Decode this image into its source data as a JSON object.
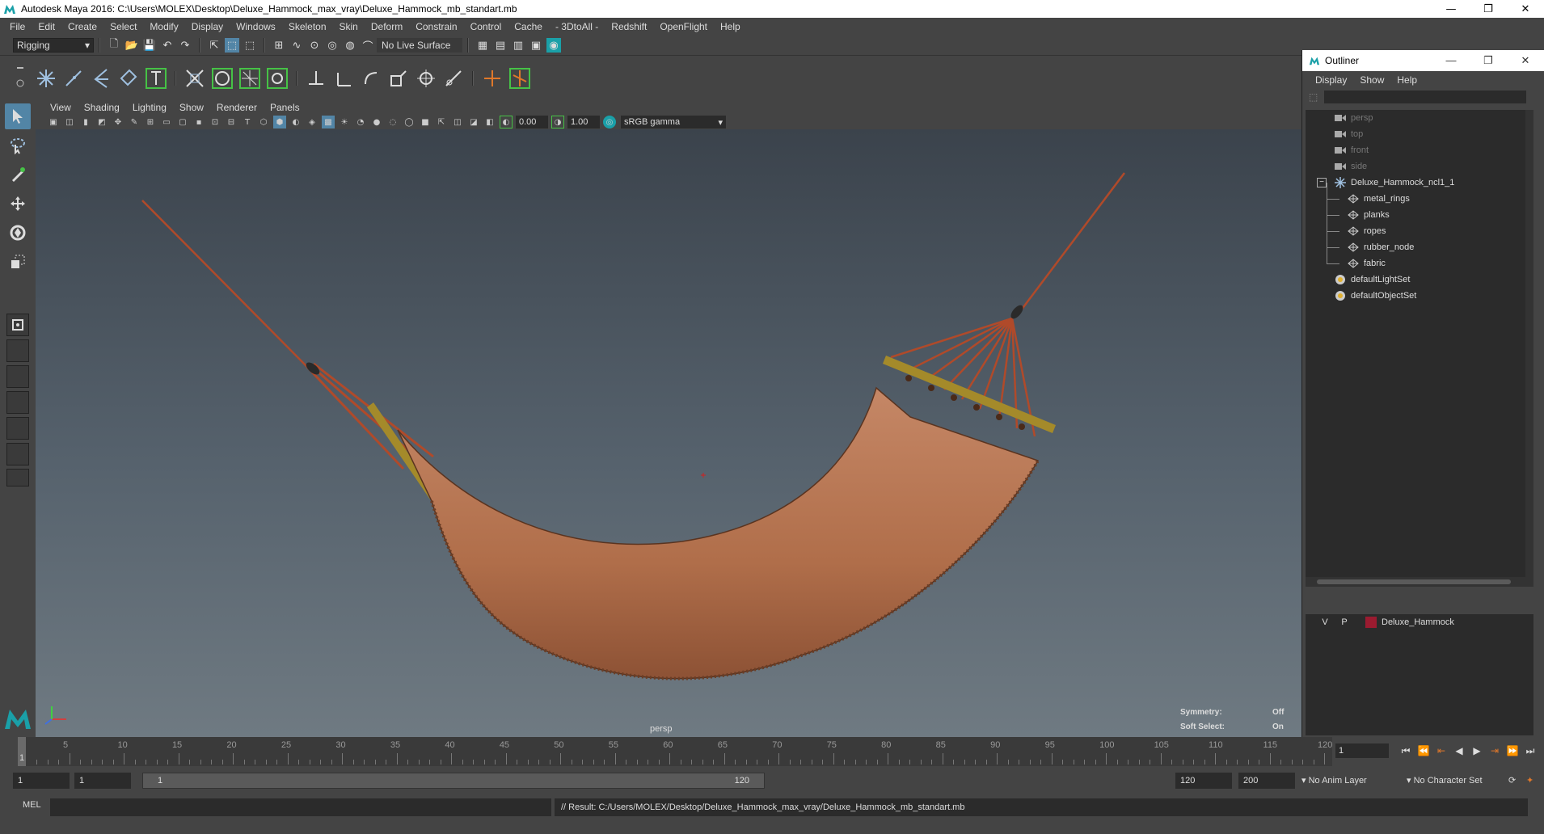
{
  "window": {
    "title": "Autodesk Maya 2016: C:\\Users\\MOLEX\\Desktop\\Deluxe_Hammock_max_vray\\Deluxe_Hammock_mb_standart.mb",
    "minimize": "—",
    "restore": "❐",
    "close": "✕"
  },
  "menubar": [
    "File",
    "Edit",
    "Create",
    "Select",
    "Modify",
    "Display",
    "Windows",
    "Skeleton",
    "Skin",
    "Deform",
    "Constrain",
    "Control",
    "Cache",
    "- 3DtoAll -",
    "Redshift",
    "OpenFlight",
    "Help"
  ],
  "statusline": {
    "mode": "Rigging",
    "live_surface": "No Live Surface"
  },
  "panel": {
    "menu": [
      "View",
      "Shading",
      "Lighting",
      "Show",
      "Renderer",
      "Panels"
    ],
    "exposure": "0.00",
    "gamma_value": "1.00",
    "color_space": "sRGB gamma",
    "camera": "persp",
    "symmetry_label": "Symmetry:",
    "symmetry_value": "Off",
    "soft_select_label": "Soft Select:",
    "soft_select_value": "On"
  },
  "outliner": {
    "title": "Outliner",
    "menu": [
      "Display",
      "Show",
      "Help"
    ],
    "items": [
      {
        "label": "persp",
        "type": "camera",
        "indent": 0,
        "dim": true
      },
      {
        "label": "top",
        "type": "camera",
        "indent": 0,
        "dim": true
      },
      {
        "label": "front",
        "type": "camera",
        "indent": 0,
        "dim": true
      },
      {
        "label": "side",
        "type": "camera",
        "indent": 0,
        "dim": true
      },
      {
        "label": "Deluxe_Hammock_ncl1_1",
        "type": "group",
        "indent": 0,
        "dim": false
      },
      {
        "label": "metal_rings",
        "type": "mesh",
        "indent": 1,
        "dim": false
      },
      {
        "label": "planks",
        "type": "mesh",
        "indent": 1,
        "dim": false
      },
      {
        "label": "ropes",
        "type": "mesh",
        "indent": 1,
        "dim": false
      },
      {
        "label": "rubber_node",
        "type": "mesh",
        "indent": 1,
        "dim": false
      },
      {
        "label": "fabric",
        "type": "mesh",
        "indent": 1,
        "dim": false
      },
      {
        "label": "defaultLightSet",
        "type": "set",
        "indent": 0,
        "dim": false
      },
      {
        "label": "defaultObjectSet",
        "type": "set",
        "indent": 0,
        "dim": false
      }
    ]
  },
  "layers": [
    {
      "v": "V",
      "p": "P",
      "name": "Deluxe_Hammock",
      "color": "#9b1b30"
    }
  ],
  "timeline": {
    "ticks": [
      5,
      10,
      15,
      20,
      25,
      30,
      35,
      40,
      45,
      50,
      55,
      60,
      65,
      70,
      75,
      80,
      85,
      90,
      95,
      100,
      105,
      110,
      115,
      120
    ],
    "start_label": "1",
    "current_frame": "1"
  },
  "range": {
    "start": "1",
    "playback_start": "1",
    "range_start": "1",
    "range_end": "120",
    "playback_end": "120",
    "end": "200",
    "anim_layer": "No Anim Layer",
    "character_set": "No Character Set"
  },
  "command": {
    "lang": "MEL",
    "result": "// Result: C:/Users/MOLEX/Desktop/Deluxe_Hammock_max_vray/Deluxe_Hammock_mb_standart.mb"
  },
  "colors": {
    "fabric": "#b87550",
    "rope": "#b04a2a",
    "plank": "#a48a2a",
    "accent": "#5285a6"
  }
}
